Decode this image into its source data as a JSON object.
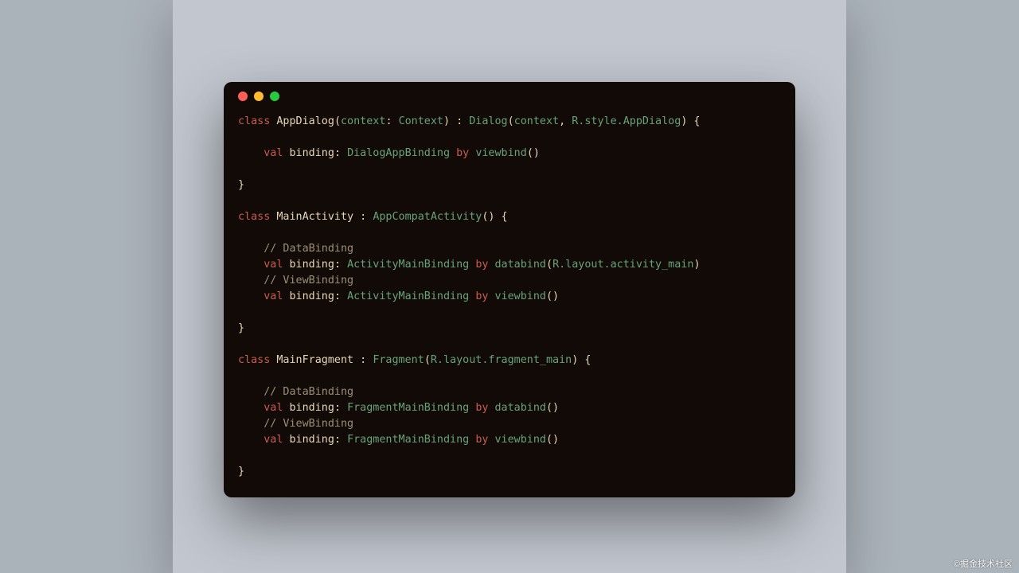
{
  "watermark": "©掘金技术社区",
  "window": {
    "dot_colors": {
      "red": "#ff5f56",
      "yellow": "#ffbd2e",
      "green": "#27c93f"
    }
  },
  "code": {
    "t": {
      "class": "class",
      "val": "val",
      "by": "by",
      "AppDialog": "AppDialog",
      "context_param": "context",
      "Context": "Context",
      "Dialog": "Dialog",
      "context_arg": "context",
      "R_style_AppDialog": "R.style.AppDialog",
      "binding": "binding",
      "DialogAppBinding": "DialogAppBinding",
      "viewbind": "viewbind",
      "MainActivity": "MainActivity",
      "AppCompatActivity": "AppCompatActivity",
      "cmt_databinding": "// DataBinding",
      "ActivityMainBinding": "ActivityMainBinding",
      "databind": "databind",
      "R_layout_activity_main": "R.layout.activity_main",
      "cmt_viewbinding": "// ViewBinding",
      "MainFragment": "MainFragment",
      "Fragment": "Fragment",
      "R_layout_fragment_main": "R.layout.fragment_main",
      "FragmentMainBinding": "FragmentMainBinding"
    }
  }
}
